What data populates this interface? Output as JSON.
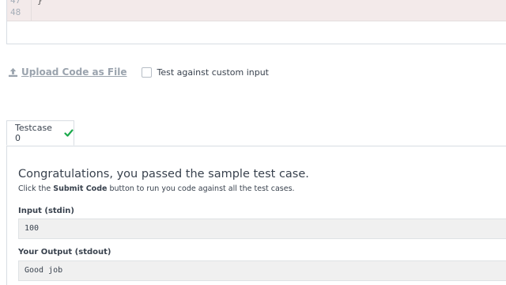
{
  "editor": {
    "lines": [
      {
        "num": "47",
        "code": "}"
      },
      {
        "num": "48",
        "code": ""
      }
    ]
  },
  "upload": {
    "label": "Upload Code as File",
    "icon": "upload-icon"
  },
  "custom_input": {
    "label": "Test against custom input",
    "checked": false
  },
  "tabs": [
    {
      "label": "Testcase 0",
      "status": "passed",
      "icon": "checkmark-icon",
      "color": "#1ba94c"
    }
  ],
  "result": {
    "title": "Congratulations, you passed the sample test case.",
    "sub_prefix": "Click the ",
    "sub_bold": "Submit Code",
    "sub_suffix": " button to run you code against all the test cases.",
    "input_label": "Input (stdin)",
    "input_value": "100",
    "output_label": "Your Output (stdout)",
    "output_value": "Good job"
  }
}
